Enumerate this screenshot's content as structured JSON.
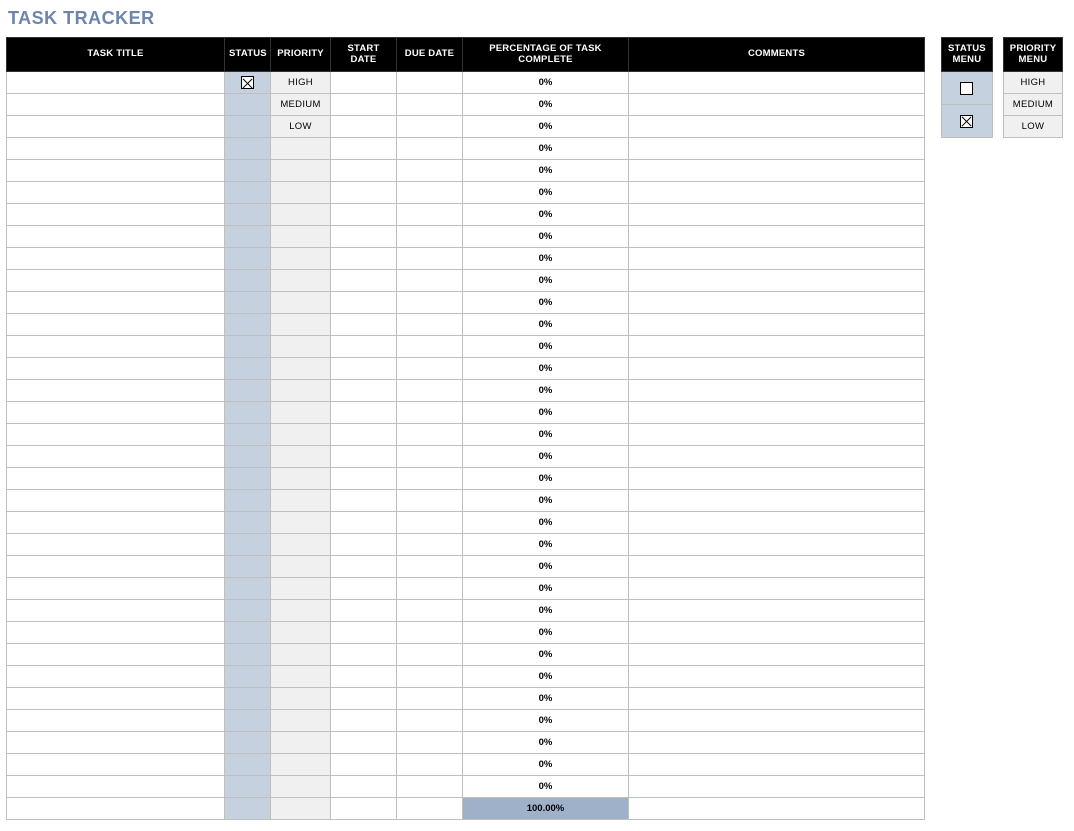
{
  "title": "TASK TRACKER",
  "columns": {
    "task_title": "TASK TITLE",
    "status": "STATUS",
    "priority": "PRIORITY",
    "start_date": "START DATE",
    "due_date": "DUE DATE",
    "pct": "PERCENTAGE OF TASK COMPLETE",
    "comments": "COMMENTS"
  },
  "rows": [
    {
      "title": "",
      "status": true,
      "priority": "HIGH",
      "start": "",
      "due": "",
      "pct": "0%",
      "comments": ""
    },
    {
      "title": "",
      "status": null,
      "priority": "MEDIUM",
      "start": "",
      "due": "",
      "pct": "0%",
      "comments": ""
    },
    {
      "title": "",
      "status": null,
      "priority": "LOW",
      "start": "",
      "due": "",
      "pct": "0%",
      "comments": ""
    },
    {
      "title": "",
      "status": null,
      "priority": "",
      "start": "",
      "due": "",
      "pct": "0%",
      "comments": ""
    },
    {
      "title": "",
      "status": null,
      "priority": "",
      "start": "",
      "due": "",
      "pct": "0%",
      "comments": ""
    },
    {
      "title": "",
      "status": null,
      "priority": "",
      "start": "",
      "due": "",
      "pct": "0%",
      "comments": ""
    },
    {
      "title": "",
      "status": null,
      "priority": "",
      "start": "",
      "due": "",
      "pct": "0%",
      "comments": ""
    },
    {
      "title": "",
      "status": null,
      "priority": "",
      "start": "",
      "due": "",
      "pct": "0%",
      "comments": ""
    },
    {
      "title": "",
      "status": null,
      "priority": "",
      "start": "",
      "due": "",
      "pct": "0%",
      "comments": ""
    },
    {
      "title": "",
      "status": null,
      "priority": "",
      "start": "",
      "due": "",
      "pct": "0%",
      "comments": ""
    },
    {
      "title": "",
      "status": null,
      "priority": "",
      "start": "",
      "due": "",
      "pct": "0%",
      "comments": ""
    },
    {
      "title": "",
      "status": null,
      "priority": "",
      "start": "",
      "due": "",
      "pct": "0%",
      "comments": ""
    },
    {
      "title": "",
      "status": null,
      "priority": "",
      "start": "",
      "due": "",
      "pct": "0%",
      "comments": ""
    },
    {
      "title": "",
      "status": null,
      "priority": "",
      "start": "",
      "due": "",
      "pct": "0%",
      "comments": ""
    },
    {
      "title": "",
      "status": null,
      "priority": "",
      "start": "",
      "due": "",
      "pct": "0%",
      "comments": ""
    },
    {
      "title": "",
      "status": null,
      "priority": "",
      "start": "",
      "due": "",
      "pct": "0%",
      "comments": ""
    },
    {
      "title": "",
      "status": null,
      "priority": "",
      "start": "",
      "due": "",
      "pct": "0%",
      "comments": ""
    },
    {
      "title": "",
      "status": null,
      "priority": "",
      "start": "",
      "due": "",
      "pct": "0%",
      "comments": ""
    },
    {
      "title": "",
      "status": null,
      "priority": "",
      "start": "",
      "due": "",
      "pct": "0%",
      "comments": ""
    },
    {
      "title": "",
      "status": null,
      "priority": "",
      "start": "",
      "due": "",
      "pct": "0%",
      "comments": ""
    },
    {
      "title": "",
      "status": null,
      "priority": "",
      "start": "",
      "due": "",
      "pct": "0%",
      "comments": ""
    },
    {
      "title": "",
      "status": null,
      "priority": "",
      "start": "",
      "due": "",
      "pct": "0%",
      "comments": ""
    },
    {
      "title": "",
      "status": null,
      "priority": "",
      "start": "",
      "due": "",
      "pct": "0%",
      "comments": ""
    },
    {
      "title": "",
      "status": null,
      "priority": "",
      "start": "",
      "due": "",
      "pct": "0%",
      "comments": ""
    },
    {
      "title": "",
      "status": null,
      "priority": "",
      "start": "",
      "due": "",
      "pct": "0%",
      "comments": ""
    },
    {
      "title": "",
      "status": null,
      "priority": "",
      "start": "",
      "due": "",
      "pct": "0%",
      "comments": ""
    },
    {
      "title": "",
      "status": null,
      "priority": "",
      "start": "",
      "due": "",
      "pct": "0%",
      "comments": ""
    },
    {
      "title": "",
      "status": null,
      "priority": "",
      "start": "",
      "due": "",
      "pct": "0%",
      "comments": ""
    },
    {
      "title": "",
      "status": null,
      "priority": "",
      "start": "",
      "due": "",
      "pct": "0%",
      "comments": ""
    },
    {
      "title": "",
      "status": null,
      "priority": "",
      "start": "",
      "due": "",
      "pct": "0%",
      "comments": ""
    },
    {
      "title": "",
      "status": null,
      "priority": "",
      "start": "",
      "due": "",
      "pct": "0%",
      "comments": ""
    },
    {
      "title": "",
      "status": null,
      "priority": "",
      "start": "",
      "due": "",
      "pct": "0%",
      "comments": ""
    },
    {
      "title": "",
      "status": null,
      "priority": "",
      "start": "",
      "due": "",
      "pct": "0%",
      "comments": ""
    }
  ],
  "total_pct": "100.00%",
  "status_menu": {
    "header": "STATUS MENU",
    "items": [
      false,
      true
    ]
  },
  "priority_menu": {
    "header": "PRIORITY MENU",
    "items": [
      "HIGH",
      "MEDIUM",
      "LOW"
    ]
  }
}
